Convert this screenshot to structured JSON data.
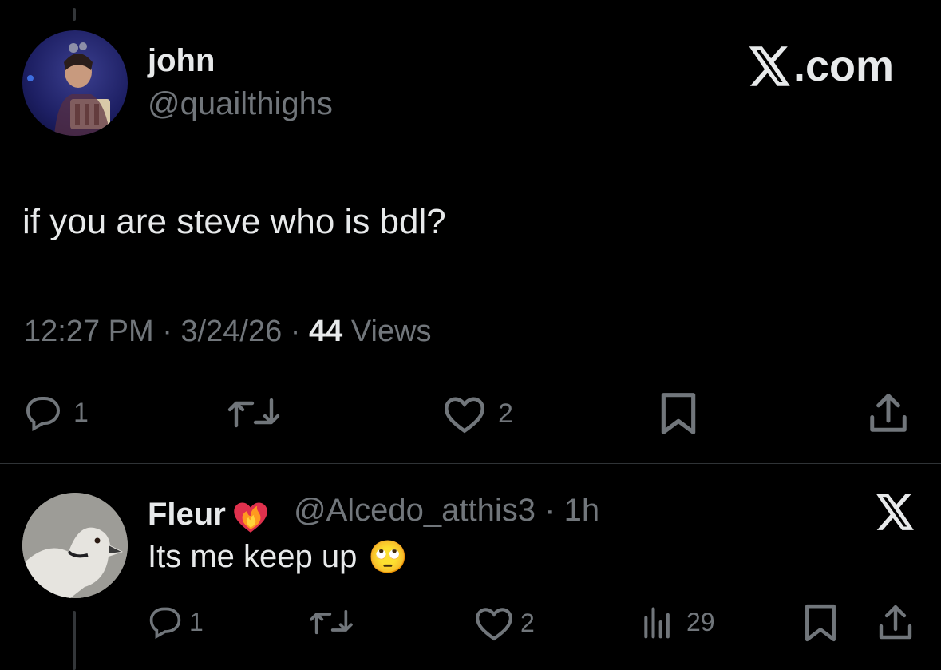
{
  "main_tweet": {
    "author_name": "john",
    "author_handle": "@quailthighs",
    "brand": "X.com",
    "text": "if you are steve who is bdl?",
    "time": "12:27 PM",
    "date": "3/24/26",
    "views_count": "44",
    "views_label": "Views",
    "separator": "·",
    "reply_count": "1",
    "like_count": "2"
  },
  "reply_tweet": {
    "author_name": "Fleur",
    "author_handle": "@Alcedo_atthis3",
    "separator": "·",
    "age": "1h",
    "text": "Its me keep up",
    "emoji": "🙄",
    "reply_count": "1",
    "like_count": "2",
    "view_count": "29"
  },
  "icons": {
    "reply": "reply-icon",
    "repost": "repost-icon",
    "like": "heart-icon",
    "bookmark": "bookmark-icon",
    "share": "share-icon",
    "views": "views-chart-icon",
    "x_logo": "x-logo-icon",
    "heart_on_fire": "heart-on-fire-emoji"
  },
  "colors": {
    "background": "#000000",
    "text": "#e7e9ea",
    "muted": "#71767b",
    "divider": "#2f3336"
  }
}
